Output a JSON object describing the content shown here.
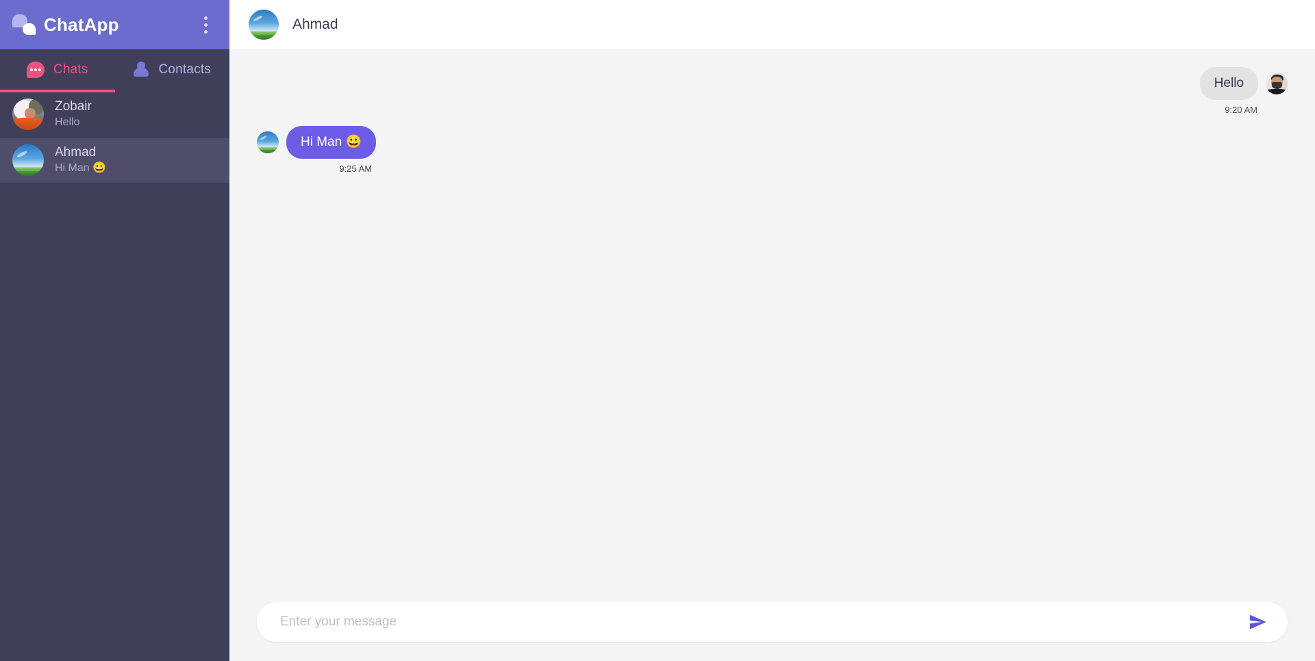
{
  "sidebar": {
    "brand": {
      "title": "ChatApp",
      "logo_icon": "chat-bubbles-icon",
      "menu_icon": "kebab-menu-icon"
    },
    "tabs": [
      {
        "label": "Chats",
        "icon": "chat-bubble-dots-icon",
        "active": true
      },
      {
        "label": "Contacts",
        "icon": "person-icon",
        "active": false
      }
    ],
    "chats": [
      {
        "name": "Zobair",
        "preview": "Hello",
        "avatar": "person-photo-avatar",
        "selected": false
      },
      {
        "name": "Ahmad",
        "preview": "Hi Man 😀",
        "avatar": "landscape-avatar",
        "selected": true
      }
    ]
  },
  "chat_header": {
    "name": "Ahmad",
    "avatar": "landscape-avatar"
  },
  "messages": [
    {
      "direction": "out",
      "text": "Hello",
      "time": "9:20 AM",
      "avatar": "user-photo-avatar"
    },
    {
      "direction": "in",
      "text": "Hi Man 😀",
      "time": "9:25 AM",
      "avatar": "landscape-avatar"
    }
  ],
  "composer": {
    "placeholder": "Enter your message",
    "value": "",
    "send_icon": "send-paper-plane-icon"
  },
  "colors": {
    "brand_purple": "#6c6cce",
    "sidebar_bg": "#3f3f5a",
    "sidebar_selected": "#4e4e6b",
    "accent_pink": "#f2527d",
    "bubble_in": "#6c5ce7",
    "bubble_out": "#e2e2e2",
    "panel_bg": "#f4f4f5"
  }
}
